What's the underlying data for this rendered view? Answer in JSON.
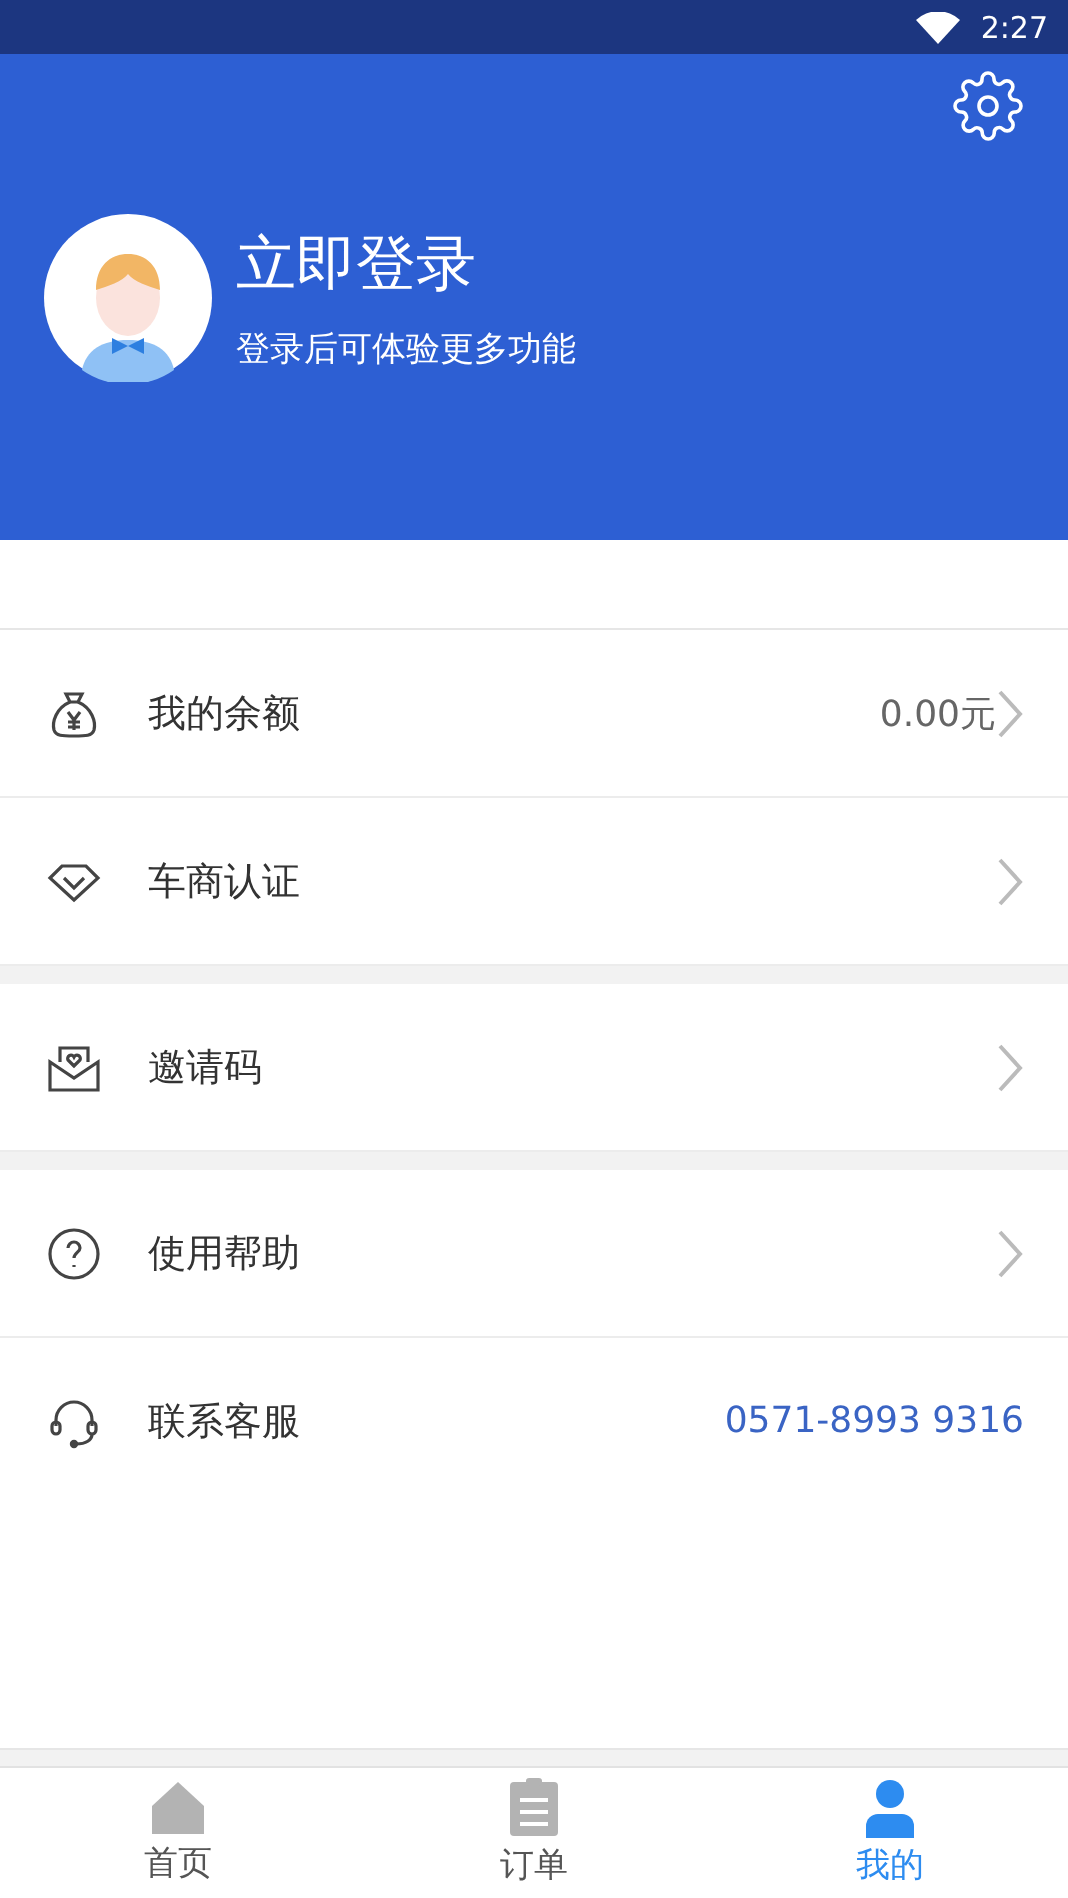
{
  "status_bar": {
    "time": "2:27"
  },
  "profile": {
    "title": "立即登录",
    "subtitle": "登录后可体验更多功能"
  },
  "menu_groups": [
    {
      "items": [
        {
          "kind": "nav",
          "label": "我的余额",
          "value": "0.00元"
        },
        {
          "kind": "nav",
          "label": "车商认证"
        }
      ]
    },
    {
      "items": [
        {
          "kind": "nav",
          "label": "邀请码"
        }
      ]
    },
    {
      "items": [
        {
          "kind": "nav",
          "label": "使用帮助"
        },
        {
          "kind": "contact",
          "label": "联系客服",
          "value": "0571-8993 9316"
        }
      ]
    }
  ],
  "tabs": [
    {
      "label": "首页",
      "selected": false
    },
    {
      "label": "订单",
      "selected": false
    },
    {
      "label": "我的",
      "selected": true
    }
  ]
}
